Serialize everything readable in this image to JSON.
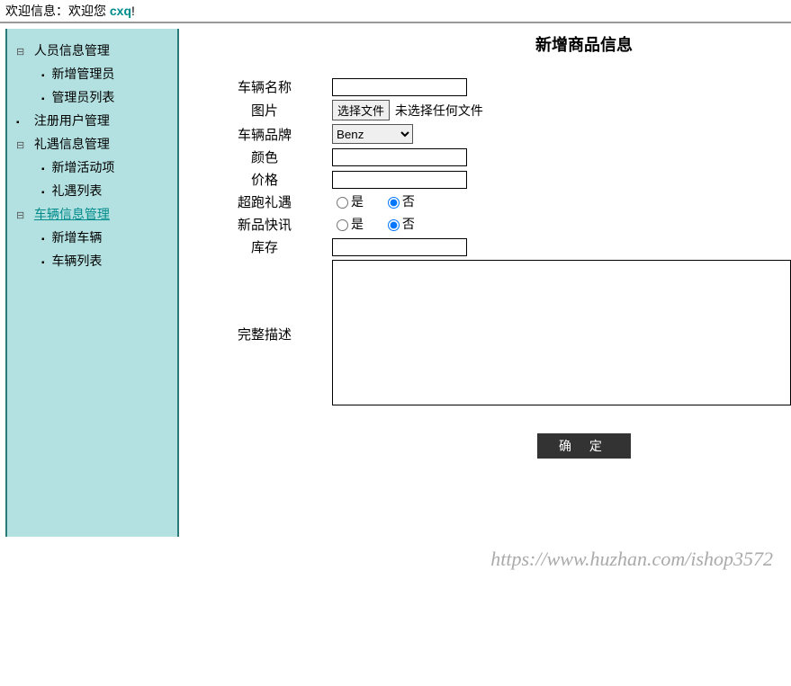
{
  "header": {
    "welcome_label": "欢迎信息：欢迎您 ",
    "username": "cxq",
    "exclaim": "!"
  },
  "sidebar": {
    "groups": [
      {
        "label": "人员信息管理",
        "expandable": true,
        "active": false,
        "children": [
          {
            "label": "新增管理员"
          },
          {
            "label": "管理员列表"
          }
        ]
      },
      {
        "label": "注册用户管理",
        "expandable": false,
        "active": false,
        "children": []
      },
      {
        "label": "礼遇信息管理",
        "expandable": true,
        "active": false,
        "children": [
          {
            "label": "新增活动项"
          },
          {
            "label": "礼遇列表"
          }
        ]
      },
      {
        "label": "车辆信息管理",
        "expandable": true,
        "active": true,
        "children": [
          {
            "label": "新增车辆"
          },
          {
            "label": "车辆列表"
          }
        ]
      }
    ]
  },
  "form": {
    "title": "新增商品信息",
    "labels": {
      "name": "车辆名称",
      "image": "图片",
      "brand": "车辆品牌",
      "color": "颜色",
      "price": "价格",
      "super": "超跑礼遇",
      "news": "新品快讯",
      "stock": "库存",
      "desc": "完整描述"
    },
    "file_button": "选择文件",
    "file_status": "未选择任何文件",
    "brand_selected": "Benz",
    "radio_yes": "是",
    "radio_no": "否",
    "submit_label": "确 定",
    "values": {
      "name": "",
      "color": "",
      "price": "",
      "super": "no",
      "news": "no",
      "stock": "",
      "desc": ""
    }
  },
  "watermark": "https://www.huzhan.com/ishop3572"
}
